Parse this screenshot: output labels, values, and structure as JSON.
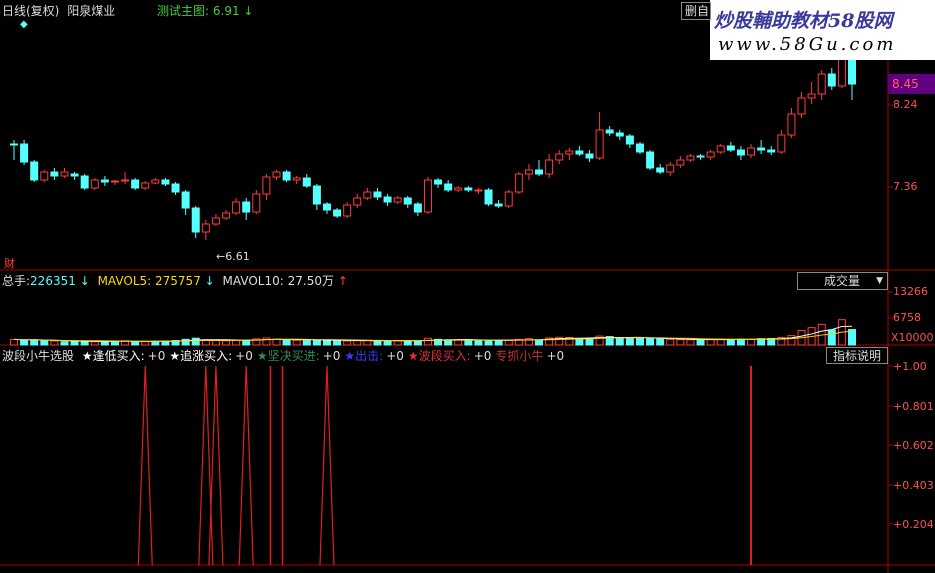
{
  "main_chart": {
    "period_label": "日线(复权)",
    "stock_name": "阳泉煤业",
    "indicator_label": "测试主图:",
    "indicator_value": "6.91",
    "indicator_arrow": "↓",
    "low_marker": "6.61",
    "finance_icon_label": "财",
    "delete_button": "删自",
    "price_axis": [
      "8.24",
      "7.36"
    ],
    "current_price_tag": "8.45"
  },
  "watermark": {
    "line1": "炒股輔助教材58股网",
    "line2": "www.58Gu.com"
  },
  "volume_panel": {
    "total_label": "总手:",
    "total_value": "226351",
    "total_arrow": "↓",
    "mavol5_label": "MAVOL5:",
    "mavol5_value": "275757",
    "mavol5_arrow": "↓",
    "mavol10_label": "MAVOL10:",
    "mavol10_value": "27.50万",
    "mavol10_arrow": "↑",
    "selector_value": "成交量",
    "axis": [
      "13266",
      "6758",
      "X10000"
    ]
  },
  "indicator_panel": {
    "name": "波段小牛选股",
    "items": [
      {
        "label": "★逢低买入:",
        "value": "+0",
        "color": "#ffffff"
      },
      {
        "label": "★追涨买入:",
        "value": "+0",
        "color": "#ffffff"
      },
      {
        "label": "★坚决买进:",
        "value": "+0",
        "color": "#2e8b57"
      },
      {
        "label": "★出击:",
        "value": "+0",
        "color": "#3a3aff"
      },
      {
        "label": "★波段买入:",
        "value": "+0",
        "color": "#e03030"
      },
      {
        "label": "专抓小牛",
        "value": "+0",
        "color": "#c03030"
      }
    ],
    "explain_button": "指标说明",
    "axis": [
      "+1.00",
      "+0.801",
      "+0.602",
      "+0.403",
      "+0.204"
    ]
  },
  "colors": {
    "up": "#ff3c3c",
    "down": "#54ffff",
    "frame": "#b00000",
    "signal": "#e02020",
    "ma": "#ffffff",
    "axis_text": "#ff5050",
    "green_text": "#40d040",
    "yellow_text": "#ffd700"
  },
  "chart_data": {
    "type": "candlestick",
    "price_range": [
      6.4,
      8.9
    ],
    "candles": [
      [
        7.66,
        7.65,
        7.7,
        7.5
      ],
      [
        7.66,
        7.48,
        7.7,
        7.45
      ],
      [
        7.48,
        7.3,
        7.5,
        7.28
      ],
      [
        7.3,
        7.38,
        7.4,
        7.28
      ],
      [
        7.38,
        7.34,
        7.42,
        7.3
      ],
      [
        7.34,
        7.38,
        7.42,
        7.32
      ],
      [
        7.36,
        7.34,
        7.38,
        7.3
      ],
      [
        7.34,
        7.22,
        7.36,
        7.2
      ],
      [
        7.22,
        7.3,
        7.32,
        7.2
      ],
      [
        7.3,
        7.28,
        7.34,
        7.24
      ],
      [
        7.28,
        7.29,
        7.3,
        7.25
      ],
      [
        7.29,
        7.3,
        7.38,
        7.26
      ],
      [
        7.3,
        7.22,
        7.32,
        7.2
      ],
      [
        7.22,
        7.27,
        7.29,
        7.2
      ],
      [
        7.27,
        7.3,
        7.32,
        7.26
      ],
      [
        7.3,
        7.26,
        7.32,
        7.24
      ],
      [
        7.26,
        7.18,
        7.28,
        7.15
      ],
      [
        7.18,
        7.02,
        7.2,
        6.95
      ],
      [
        7.02,
        6.78,
        7.04,
        6.72
      ],
      [
        6.78,
        6.86,
        6.9,
        6.7
      ],
      [
        6.86,
        6.92,
        6.96,
        6.84
      ],
      [
        6.92,
        6.97,
        7.0,
        6.9
      ],
      [
        6.97,
        7.08,
        7.12,
        6.95
      ],
      [
        7.08,
        6.98,
        7.12,
        6.9
      ],
      [
        6.98,
        7.16,
        7.2,
        6.96
      ],
      [
        7.16,
        7.33,
        7.36,
        7.1
      ],
      [
        7.33,
        7.38,
        7.4,
        7.3
      ],
      [
        7.38,
        7.3,
        7.4,
        7.28
      ],
      [
        7.3,
        7.32,
        7.34,
        7.26
      ],
      [
        7.32,
        7.24,
        7.36,
        7.22
      ],
      [
        7.24,
        7.06,
        7.26,
        7.0
      ],
      [
        7.06,
        7.0,
        7.08,
        6.96
      ],
      [
        7.0,
        6.94,
        7.02,
        6.92
      ],
      [
        6.94,
        7.05,
        7.08,
        6.92
      ],
      [
        7.05,
        7.12,
        7.16,
        7.02
      ],
      [
        7.12,
        7.18,
        7.22,
        7.1
      ],
      [
        7.18,
        7.13,
        7.22,
        7.1
      ],
      [
        7.13,
        7.08,
        7.16,
        7.04
      ],
      [
        7.08,
        7.12,
        7.14,
        7.06
      ],
      [
        7.12,
        7.06,
        7.14,
        7.02
      ],
      [
        7.06,
        6.98,
        7.08,
        6.94
      ],
      [
        6.98,
        7.3,
        7.33,
        6.96
      ],
      [
        7.3,
        7.26,
        7.32,
        7.22
      ],
      [
        7.26,
        7.2,
        7.3,
        7.18
      ],
      [
        7.2,
        7.22,
        7.24,
        7.18
      ],
      [
        7.22,
        7.2,
        7.24,
        7.18
      ],
      [
        7.2,
        7.2,
        7.22,
        7.16
      ],
      [
        7.2,
        7.06,
        7.22,
        7.04
      ],
      [
        7.06,
        7.04,
        7.1,
        7.02
      ],
      [
        7.04,
        7.18,
        7.2,
        7.02
      ],
      [
        7.18,
        7.36,
        7.38,
        7.16
      ],
      [
        7.36,
        7.4,
        7.46,
        7.3
      ],
      [
        7.4,
        7.36,
        7.5,
        7.34
      ],
      [
        7.36,
        7.5,
        7.56,
        7.32
      ],
      [
        7.5,
        7.56,
        7.6,
        7.46
      ],
      [
        7.56,
        7.59,
        7.62,
        7.5
      ],
      [
        7.59,
        7.56,
        7.64,
        7.54
      ],
      [
        7.56,
        7.52,
        7.6,
        7.48
      ],
      [
        7.52,
        7.8,
        7.98,
        7.5
      ],
      [
        7.8,
        7.77,
        7.84,
        7.74
      ],
      [
        7.77,
        7.74,
        7.8,
        7.7
      ],
      [
        7.74,
        7.66,
        7.76,
        7.62
      ],
      [
        7.66,
        7.58,
        7.68,
        7.56
      ],
      [
        7.58,
        7.42,
        7.6,
        7.4
      ],
      [
        7.42,
        7.38,
        7.46,
        7.36
      ],
      [
        7.38,
        7.45,
        7.48,
        7.34
      ],
      [
        7.45,
        7.5,
        7.54,
        7.42
      ],
      [
        7.5,
        7.54,
        7.56,
        7.48
      ],
      [
        7.54,
        7.53,
        7.56,
        7.5
      ],
      [
        7.53,
        7.58,
        7.6,
        7.5
      ],
      [
        7.58,
        7.64,
        7.66,
        7.56
      ],
      [
        7.64,
        7.6,
        7.68,
        7.58
      ],
      [
        7.6,
        7.55,
        7.64,
        7.5
      ],
      [
        7.55,
        7.62,
        7.66,
        7.52
      ],
      [
        7.62,
        7.6,
        7.7,
        7.56
      ],
      [
        7.6,
        7.58,
        7.64,
        7.55
      ],
      [
        7.58,
        7.75,
        7.8,
        7.56
      ],
      [
        7.75,
        7.96,
        8.02,
        7.72
      ],
      [
        7.96,
        8.12,
        8.18,
        7.92
      ],
      [
        8.12,
        8.16,
        8.28,
        8.06
      ],
      [
        8.16,
        8.36,
        8.4,
        8.1
      ],
      [
        8.36,
        8.24,
        8.42,
        8.2
      ],
      [
        8.24,
        8.78,
        8.9,
        8.22
      ],
      [
        8.78,
        8.26,
        8.82,
        8.1
      ]
    ],
    "volume_range": [
      0,
      160000
    ],
    "volumes": [
      [
        12000,
        1
      ],
      [
        10500,
        0
      ],
      [
        11000,
        0
      ],
      [
        9000,
        0
      ],
      [
        8500,
        1
      ],
      [
        7000,
        0
      ],
      [
        7500,
        0
      ],
      [
        8000,
        0
      ],
      [
        7000,
        1
      ],
      [
        8000,
        0
      ],
      [
        8500,
        0
      ],
      [
        9000,
        1
      ],
      [
        7500,
        0
      ],
      [
        7000,
        1
      ],
      [
        8000,
        0
      ],
      [
        8500,
        0
      ],
      [
        9500,
        0
      ],
      [
        12000,
        0
      ],
      [
        14500,
        0
      ],
      [
        11000,
        1
      ],
      [
        9500,
        1
      ],
      [
        9000,
        1
      ],
      [
        10000,
        1
      ],
      [
        10500,
        0
      ],
      [
        13000,
        1
      ],
      [
        15000,
        1
      ],
      [
        12500,
        1
      ],
      [
        11000,
        0
      ],
      [
        10000,
        1
      ],
      [
        11500,
        0
      ],
      [
        10500,
        0
      ],
      [
        9500,
        0
      ],
      [
        9000,
        0
      ],
      [
        8500,
        1
      ],
      [
        9500,
        1
      ],
      [
        10000,
        1
      ],
      [
        9000,
        0
      ],
      [
        9500,
        0
      ],
      [
        8500,
        1
      ],
      [
        8500,
        0
      ],
      [
        9000,
        0
      ],
      [
        14500,
        1
      ],
      [
        12000,
        0
      ],
      [
        11000,
        0
      ],
      [
        11500,
        1
      ],
      [
        10000,
        0
      ],
      [
        10000,
        0
      ],
      [
        9500,
        0
      ],
      [
        9500,
        0
      ],
      [
        10500,
        1
      ],
      [
        12000,
        1
      ],
      [
        13500,
        1
      ],
      [
        11000,
        0
      ],
      [
        15000,
        1
      ],
      [
        16500,
        1
      ],
      [
        16000,
        1
      ],
      [
        14000,
        0
      ],
      [
        13500,
        0
      ],
      [
        19000,
        1
      ],
      [
        18000,
        0
      ],
      [
        15000,
        0
      ],
      [
        15000,
        0
      ],
      [
        14500,
        0
      ],
      [
        14000,
        0
      ],
      [
        12500,
        0
      ],
      [
        12000,
        1
      ],
      [
        11500,
        1
      ],
      [
        11000,
        1
      ],
      [
        11000,
        0
      ],
      [
        12000,
        1
      ],
      [
        12500,
        1
      ],
      [
        12000,
        0
      ],
      [
        12500,
        0
      ],
      [
        12000,
        1
      ],
      [
        13500,
        0
      ],
      [
        14000,
        0
      ],
      [
        16000,
        1
      ],
      [
        20000,
        1
      ],
      [
        31000,
        1
      ],
      [
        37000,
        1
      ],
      [
        44000,
        1
      ],
      [
        32000,
        0
      ],
      [
        54000,
        1
      ],
      [
        33000,
        0
      ]
    ],
    "signal_peaks": [
      13,
      19,
      20,
      23,
      31
    ]
  }
}
